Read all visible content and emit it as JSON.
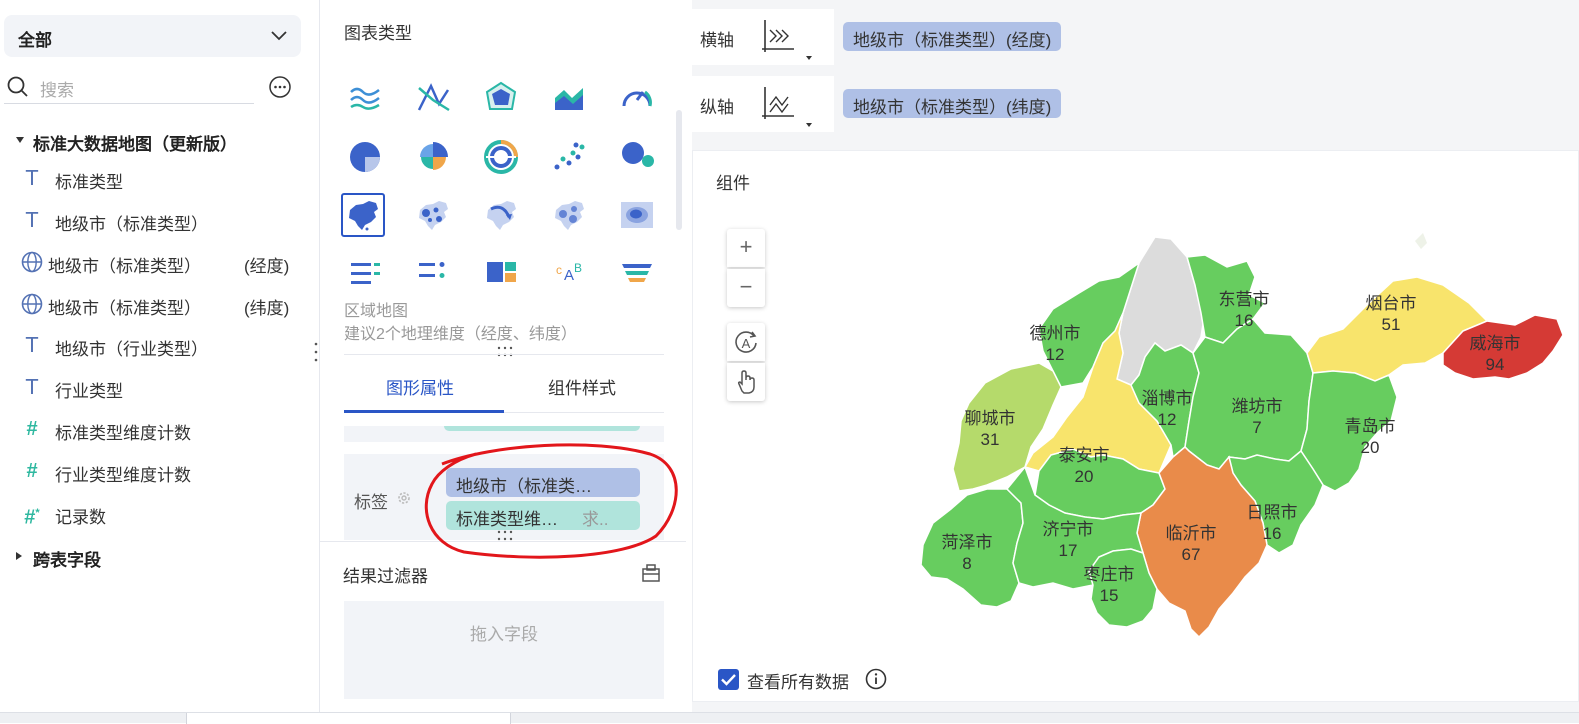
{
  "left": {
    "dropdown_label": "全部",
    "search_placeholder": "搜索",
    "tree_title": "标准大数据地图（更新版）",
    "fields": [
      {
        "label": "标准类型"
      },
      {
        "label": "地级市（标准类型）"
      },
      {
        "label": "地级市（标准类型）",
        "suffix": "(经度)"
      },
      {
        "label": "地级市（标准类型）",
        "suffix": "(纬度)"
      },
      {
        "label": "地级市（行业类型）"
      },
      {
        "label": "行业类型"
      },
      {
        "label": "标准类型维度计数"
      },
      {
        "label": "行业类型维度计数"
      },
      {
        "label": "记录数"
      }
    ],
    "cross_table": "跨表字段"
  },
  "middle": {
    "chart_type_title": "图表类型",
    "chart_type_icons": [
      "multi-line-chart-icon",
      "custom-line-chart-icon",
      "radar-chart-icon",
      "area-chart-icon",
      "gauge-chart-icon",
      "pie-chart-icon",
      "rose-pie-chart-icon",
      "multi-pie-chart-icon",
      "scatter-chart-icon",
      "bubble-chart-icon",
      "region-map-icon",
      "point-map-icon",
      "flow-map-icon",
      "heat-point-map-icon",
      "heat-map-icon",
      "text-table-icon",
      "kpi-card-icon",
      "rect-tree-icon",
      "word-cloud-icon",
      "funnel-chart-icon"
    ],
    "selected_chart_name": "区域地图",
    "selected_chart_hint": "建议2个地理维度（经度、纬度）",
    "tab_graph": "图形属性",
    "tab_style": "组件样式",
    "label_title": "标签",
    "label_pill_1": "地级市（标准类…",
    "label_pill_2": "标准类型维…",
    "label_pill_2_sub": "求..",
    "result_filter": "结果过滤器",
    "drop_hint": "拖入字段"
  },
  "right": {
    "x_axis_name": "横轴",
    "x_axis_field": "地级市（标准类型）(经度)",
    "y_axis_name": "纵轴",
    "y_axis_field": "地级市（标准类型）(纬度)",
    "component_title": "组件",
    "zoom_in": "+",
    "zoom_out": "−",
    "view_all_data": "查看所有数据",
    "view_all_checked": true,
    "map_regions": [
      {
        "name": "东营市",
        "value": "16",
        "color": "#67cd5f"
      },
      {
        "name": "烟台市",
        "value": "51",
        "color": "#f8e46c"
      },
      {
        "name": "威海市",
        "value": "94",
        "color": "#d53a35"
      },
      {
        "name": "德州市",
        "value": "12",
        "color": "#67cd5f"
      },
      {
        "name": "淄博市",
        "value": "12",
        "color": "#67cd5f"
      },
      {
        "name": "潍坊市",
        "value": "7",
        "color": "#67cd5f"
      },
      {
        "name": "聊城市",
        "value": "31",
        "color": "#b5da6b"
      },
      {
        "name": "青岛市",
        "value": "20",
        "color": "#67cd5f"
      },
      {
        "name": "泰安市",
        "value": "20",
        "color": "#67cd5f"
      },
      {
        "name": "日照市",
        "value": "16",
        "color": "#67cd5f"
      },
      {
        "name": "菏泽市",
        "value": "8",
        "color": "#67cd5f"
      },
      {
        "name": "济宁市",
        "value": "17",
        "color": "#67cd5f"
      },
      {
        "name": "临沂市",
        "value": "67",
        "color": "#e98b4a"
      },
      {
        "name": "枣庄市",
        "value": "15",
        "color": "#67cd5f"
      }
    ],
    "map_colors": {
      "no_data": "#dcdcdc",
      "jinan": "#f8e46c"
    }
  },
  "colors": {
    "accent": "#2a56c6",
    "dim_pill": "#afc0e6",
    "measure_pill": "#b0e4dc",
    "annotation": "#e2161b"
  }
}
